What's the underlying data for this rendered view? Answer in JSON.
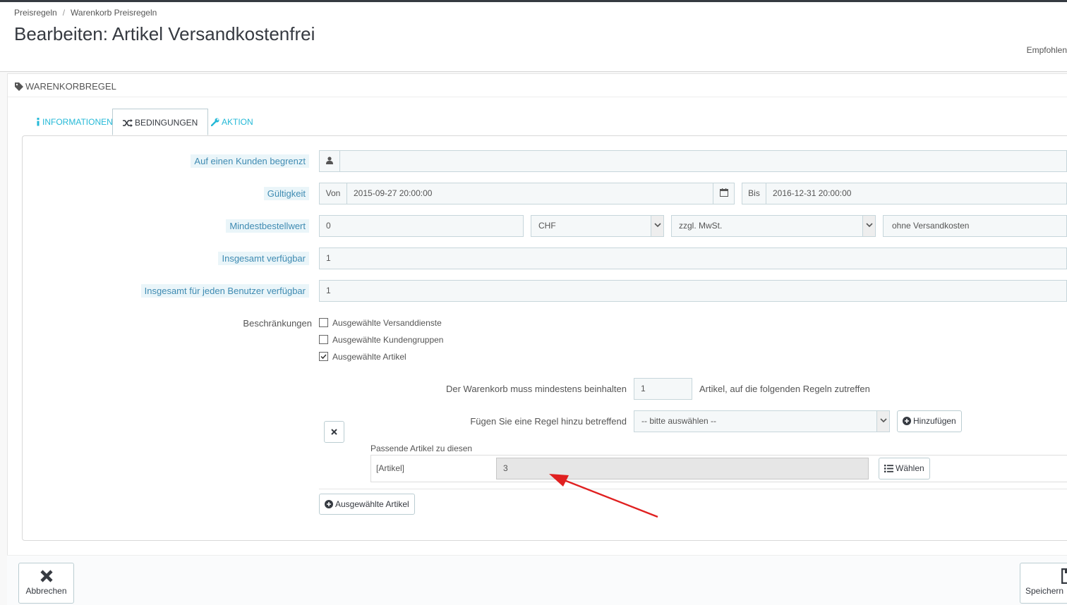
{
  "breadcrumb": {
    "item1": "Preisregeln",
    "separator": "/",
    "item2": "Warenkorb Preisregeln"
  },
  "page": {
    "title": "Bearbeiten: Artikel Versandkostenfrei",
    "recommended": "Empfohlen"
  },
  "panel": {
    "heading": "Warenkorbregel"
  },
  "tabs": [
    {
      "label": "Informationen",
      "icon": "info-icon"
    },
    {
      "label": "Bedingungen",
      "icon": "shuffle-icon",
      "active": true
    },
    {
      "label": "Aktion",
      "icon": "wrench-icon"
    }
  ],
  "form": {
    "customer": {
      "label": "Auf einen Kunden begrenzt",
      "value": "",
      "icon": "user-icon"
    },
    "validity": {
      "label": "Gültigkeit",
      "from_label": "Von",
      "from_value": "2015-09-27 20:00:00",
      "to_label": "Bis",
      "to_value": "2016-12-31 20:00:00",
      "icon": "calendar-icon"
    },
    "min_amount": {
      "label": "Mindestbestellwert",
      "value": "0",
      "currency": "CHF",
      "tax": "zzgl. MwSt.",
      "shipping": "ohne Versandkosten"
    },
    "total_available": {
      "label": "Insgesamt verfügbar",
      "value": "1"
    },
    "per_user": {
      "label": "Insgesamt für jeden Benutzer verfügbar",
      "value": "1"
    },
    "restrictions": {
      "label": "Beschränkungen",
      "options": [
        {
          "label": "Ausgewählte Versanddienste",
          "checked": false
        },
        {
          "label": "Ausgewählte Kundengruppen",
          "checked": false
        },
        {
          "label": "Ausgewählte Artikel",
          "checked": true
        }
      ]
    },
    "product_rule": {
      "min_label": "Der Warenkorb muss mindestens beinhalten",
      "min_value": "1",
      "min_suffix": "Artikel, auf die folgenden Regeln zutreffen",
      "add_rule_label": "Fügen Sie eine Regel hinzu betreffend",
      "add_rule_select": "-- bitte auswählen --",
      "add_button": "Hinzufügen",
      "matching_label": "Passende Artikel zu diesen",
      "item_label": "[Artikel]",
      "item_value": "3",
      "choose_button": "Wählen",
      "selected_button": "Ausgewählte Artikel"
    }
  },
  "footer": {
    "cancel": "Abbrechen",
    "save": "Speichern"
  },
  "colors": {
    "accent": "#25b9d7",
    "arrow": "#e02020",
    "label_hint_bg": "#eaf5f9"
  }
}
